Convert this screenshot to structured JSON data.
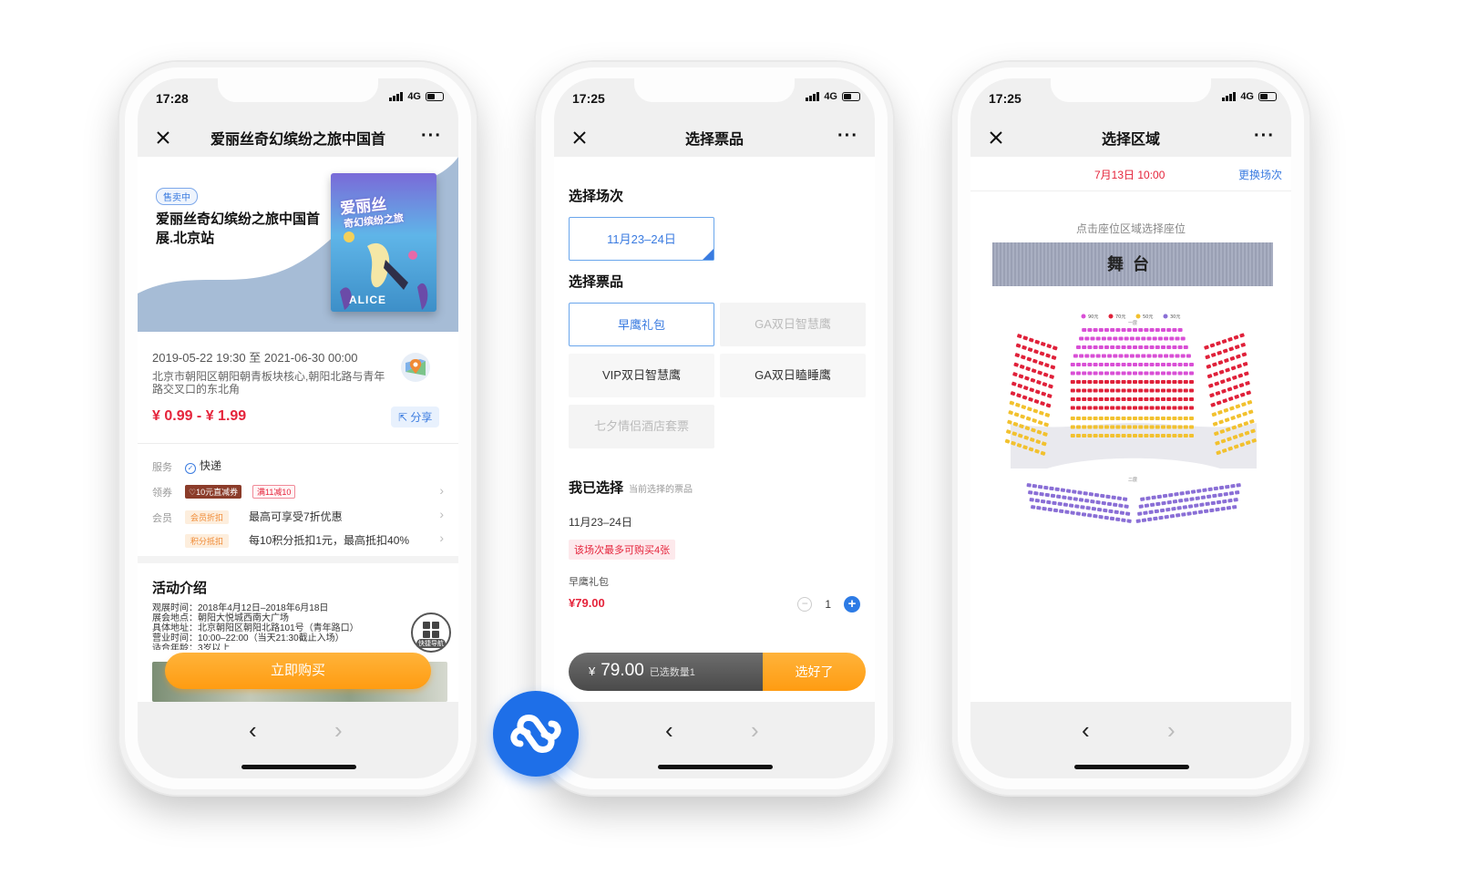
{
  "phone1": {
    "time": "17:28",
    "network": "4G",
    "title": "爱丽丝奇幻缤纷之旅中国首",
    "badge": "售卖中",
    "event_title": "爱丽丝奇幻缤纷之旅中国首展.北京站",
    "poster_title": "爱丽丝",
    "poster_subtitle": "奇幻缤纷之旅",
    "poster_footer": "ALICE",
    "date_range": "2019-05-22 19:30 至 2021-06-30 00:00",
    "address": "北京市朝阳区朝阳朝青板块核心,朝阳北路与青年路交叉口的东北角",
    "price_range": "¥ 0.99 - ¥ 1.99",
    "share": "分享",
    "service_label": "服务",
    "service_value": "快递",
    "coupon_label": "领券",
    "coupon_a": "10元直减券",
    "coupon_b": "满11减10",
    "member_label": "会员",
    "member_tag": "会员折扣",
    "member_text": "最高可享受7折优惠",
    "points_tag": "积分抵扣",
    "points_text": "每10积分抵扣1元，最高抵扣40%",
    "activity_title": "活动介绍",
    "activity_lines": [
      "观展时间：2018年4月12日–2018年6月18日",
      "展会地点：朝阳大悦城西南大广场",
      "具体地址：北京朝阳区朝阳北路101号（青年路口）",
      "营业时间：10:00–22:00（当天21:30截止入场）",
      "适合年龄：3岁以上"
    ],
    "buy_button": "立即购买",
    "fab_label": "快捷导航"
  },
  "phone2": {
    "time": "17:25",
    "network": "4G",
    "title": "选择票品",
    "session_title": "选择场次",
    "session_option": "11月23–24日",
    "ticket_title": "选择票品",
    "ticket_options": [
      "早鹰礼包",
      "GA双日智慧鹰",
      "VIP双日智慧鹰",
      "GA双日瞌睡鹰",
      "七夕情侣酒店套票"
    ],
    "chosen_title": "我已选择",
    "chosen_hint": "当前选择的票品",
    "chosen_date": "11月23–24日",
    "limit_text": "该场次最多可购买4张",
    "package_name": "早鹰礼包",
    "package_price": "¥79.00",
    "quantity": "1",
    "total_currency": "¥",
    "total_amount": "79.00",
    "selected_count": "已选数量1",
    "confirm_button": "选好了"
  },
  "phone3": {
    "time": "17:25",
    "network": "4G",
    "title": "选择区域",
    "session_date": "7月13日 10:00",
    "change_session": "更换场次",
    "hint": "点击座位区域选择座位",
    "stage_label": "舞台",
    "legend": [
      "90元",
      "70元",
      "50元",
      "30元"
    ],
    "floor1": "一层",
    "floor2": "二层"
  },
  "colors": {
    "accent_blue": "#3a7be0",
    "price_red": "#e5243b",
    "cta_orange": "#ff9c12",
    "seat_magenta": "#d94fd6",
    "seat_red": "#e0213a",
    "seat_yellow": "#f2c12e",
    "seat_purple": "#8a6fd6"
  }
}
